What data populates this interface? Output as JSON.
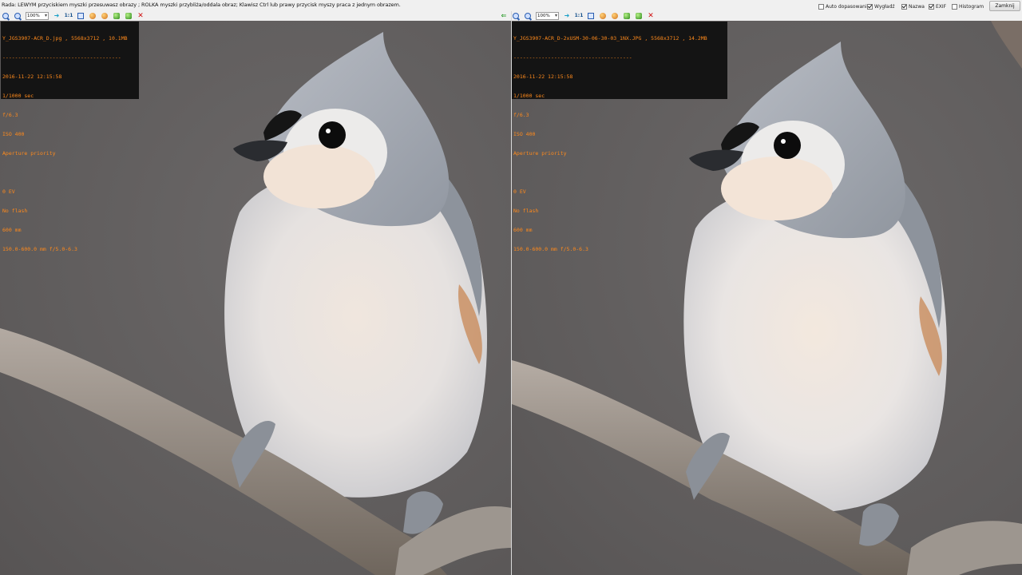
{
  "hint": "Rada: LEWYM przyciskiem myszki przesuwasz obrazy ; ROLKA myszki przybliża/oddala obraz; Klawisz Ctrl lub prawy przycisk myszy praca z jednym obrazem.",
  "options": [
    {
      "label": "Auto dopasowanie",
      "checked": false
    },
    {
      "label": "Wygładź",
      "checked": true
    },
    {
      "label": "Nazwa",
      "checked": true
    },
    {
      "label": "EXIF",
      "checked": true
    },
    {
      "label": "Histogram",
      "checked": false
    }
  ],
  "close_label": "Zamknij",
  "toolbar": {
    "zoom": "100%",
    "one_to_one": "1:1"
  },
  "left_image": {
    "header": "Y_JGS3907-ACR_D.jpg , 5568x3712 , 10.1MB",
    "separator": "--------------------------------------",
    "datetime": "2016-11-22 12:15:58",
    "shutter": "1/1000 sec",
    "aperture": "f/6.3",
    "iso": "ISO 400",
    "mode": "Aperture priority",
    "blank": "",
    "ev": "0 EV",
    "flash": "No flash",
    "focal": "600 mm",
    "lens": "150.0-600.0 mm f/5.0-6.3"
  },
  "right_image": {
    "header": "Y_JGS3907-ACR_D-2xUSM-30-06-30-03_1NX.JPG , 5568x3712 , 14.2MB",
    "separator": "--------------------------------------",
    "datetime": "2016-11-22 12:15:58",
    "shutter": "1/1000 sec",
    "aperture": "f/6.3",
    "iso": "ISO 400",
    "mode": "Aperture priority",
    "blank": "",
    "ev": "0 EV",
    "flash": "No flash",
    "focal": "600 mm",
    "lens": "150.0-600.0 mm f/5.0-6.3"
  }
}
